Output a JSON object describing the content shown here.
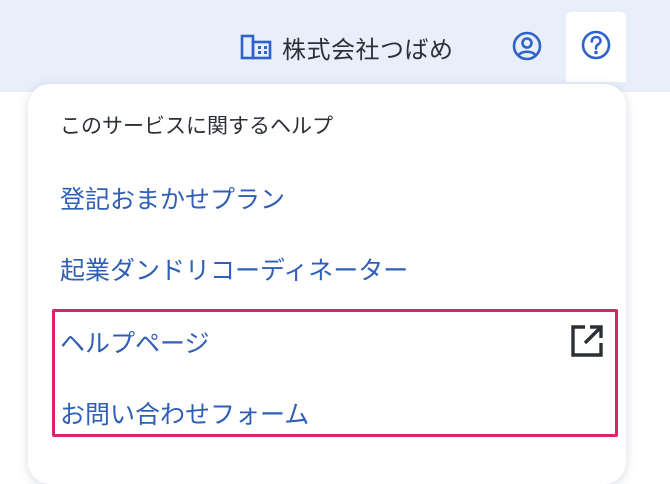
{
  "header": {
    "company_name": "株式会社つばめ",
    "company_icon": "building-icon",
    "account_icon": "account-circle-icon",
    "help_icon": "help-circle-icon"
  },
  "help_menu": {
    "heading": "このサービスに関するヘルプ",
    "items": [
      {
        "label": "登記おまかせプラン"
      },
      {
        "label": "起業ダンドリコーディネーター"
      },
      {
        "label": "ヘルプページ",
        "icon": "external-link-icon"
      },
      {
        "label": "お問い合わせフォーム"
      }
    ]
  },
  "colors": {
    "header_bg": "#e8eefa",
    "link": "#2f5fb7",
    "icon_blue": "#2f63c9",
    "highlight": "#e0206a"
  }
}
